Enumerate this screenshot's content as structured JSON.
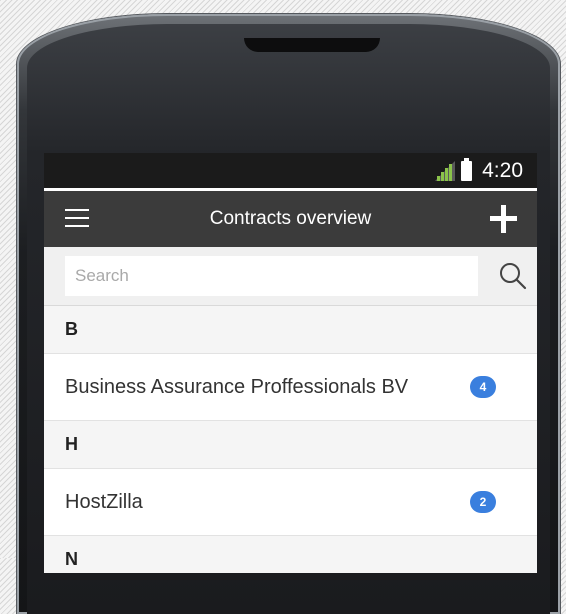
{
  "status_bar": {
    "time": "4:20"
  },
  "app_bar": {
    "title": "Contracts overview"
  },
  "search": {
    "placeholder": "Search",
    "value": ""
  },
  "sections": [
    {
      "letter": "B",
      "items": [
        {
          "name": "Business Assurance Proffessionals BV",
          "count": "4"
        }
      ]
    },
    {
      "letter": "H",
      "items": [
        {
          "name": "HostZilla",
          "count": "2"
        }
      ]
    },
    {
      "letter": "N",
      "items": []
    }
  ],
  "colors": {
    "app_bar": "#3b3b3b",
    "badge": "#3a7fde",
    "status_bar": "#1b1b1b"
  },
  "icons": [
    "menu-icon",
    "add-icon",
    "search-icon",
    "signal-icon",
    "battery-icon"
  ]
}
